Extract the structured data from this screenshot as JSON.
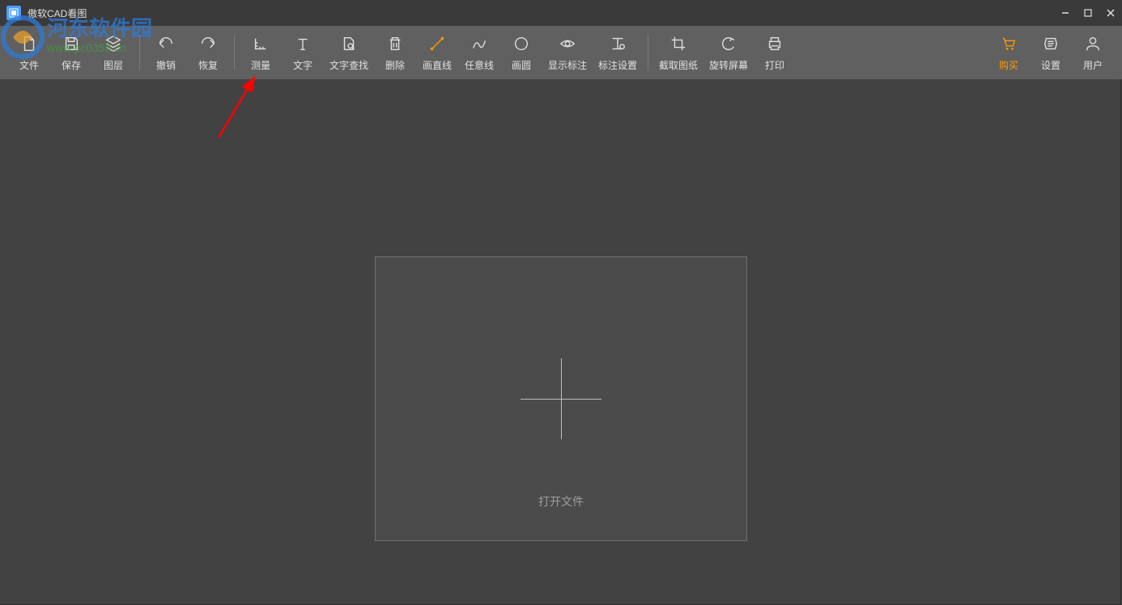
{
  "titlebar": {
    "title": "傲软CAD看图"
  },
  "watermark": {
    "line1": "河东软件园",
    "line2": "www.pc0359.cn"
  },
  "toolbar": {
    "file": "文件",
    "save": "保存",
    "layer": "图层",
    "undo": "撤销",
    "redo": "恢复",
    "measure": "测量",
    "text": "文字",
    "text_find": "文字查找",
    "delete": "删除",
    "draw_line": "画直线",
    "any_line": "任意线",
    "draw_circle": "画圆",
    "show_annotation": "显示标注",
    "annotation_settings": "标注设置",
    "crop_drawing": "截取图纸",
    "rotate_screen": "旋转屏幕",
    "print": "打印",
    "buy": "购买",
    "settings": "设置",
    "user": "用户"
  },
  "canvas": {
    "open_file": "打开文件"
  }
}
